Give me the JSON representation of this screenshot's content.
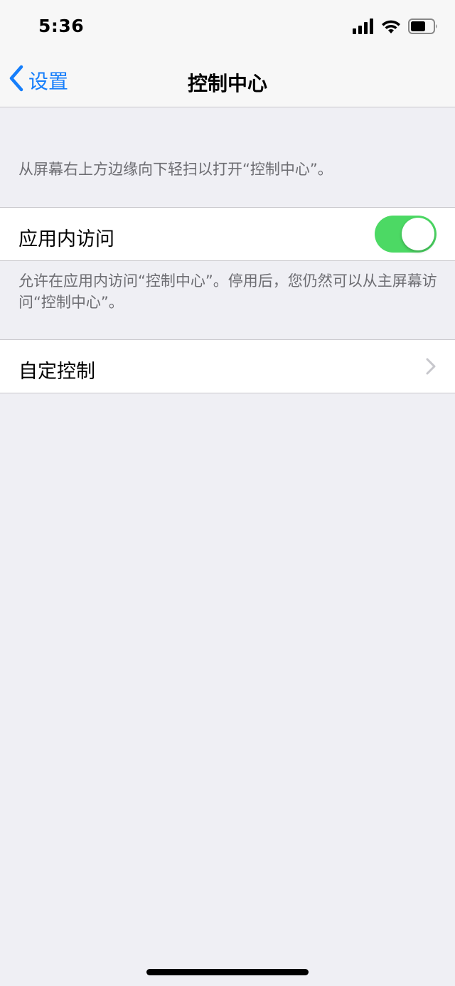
{
  "status_bar": {
    "time": "5:36",
    "icons": [
      "cellular-signal-icon",
      "wifi-icon",
      "battery-icon"
    ]
  },
  "nav": {
    "back_label": "设置",
    "title": "控制中心"
  },
  "section": {
    "header": "从屏幕右上方边缘向下轻扫以打开“控制中心”。"
  },
  "app_access": {
    "label": "应用内访问",
    "enabled": true,
    "footer": "允许在应用内访问“控制中心”。停用后，您仍然可以从主屏幕访问“控制中心”。"
  },
  "customize": {
    "label": "自定控制"
  },
  "colors": {
    "accent": "#157efb",
    "toggle_on": "#4cd964",
    "background": "#efeff4",
    "secondary_text": "#6d6d72"
  }
}
